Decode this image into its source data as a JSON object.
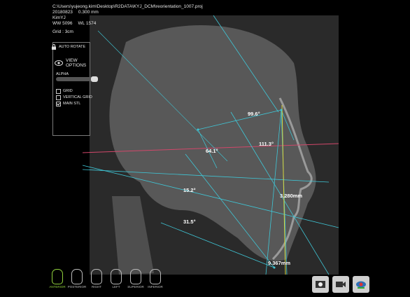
{
  "header": {
    "path": "C:\\Users\\yujeong.kim\\Desktop\\R2DATA\\KYJ_DCM\\reorientation_1007.proj",
    "date": "20180823",
    "pixel_size": "0.300 mm",
    "patient": "KimYJ",
    "ww": "WW 5096",
    "wl": "WL 1574",
    "grid": "Grid : 3cm"
  },
  "panel": {
    "auto_rotate": "AUTO ROTATE",
    "view_options": "VIEW\nOPTIONS",
    "view_options_line1": "VIEW",
    "view_options_line2": "OPTIONS",
    "alpha": "ALPHA",
    "checkboxes": [
      {
        "label": "GRID",
        "checked": false
      },
      {
        "label": "VERTICAL GRID",
        "checked": false
      },
      {
        "label": "MAIN STL",
        "checked": true
      }
    ]
  },
  "measurements": {
    "m1": "99.6°",
    "m2": "111.3°",
    "m3": "64.1°",
    "m4": "15.2°",
    "m5": "3.280mm",
    "m6": "31.5°",
    "m7": "9.367mm"
  },
  "orientation": [
    "ANTERIOR",
    "POSTERIOR",
    "RIGHT",
    "LEFT",
    "SUPERIOR",
    "INFERIOR"
  ],
  "colors": {
    "cyan_line": "#3fc6d6",
    "red_line": "#d2476a",
    "yellow_line": "#d8d23a",
    "active_orientation": "#8fcf3c"
  }
}
